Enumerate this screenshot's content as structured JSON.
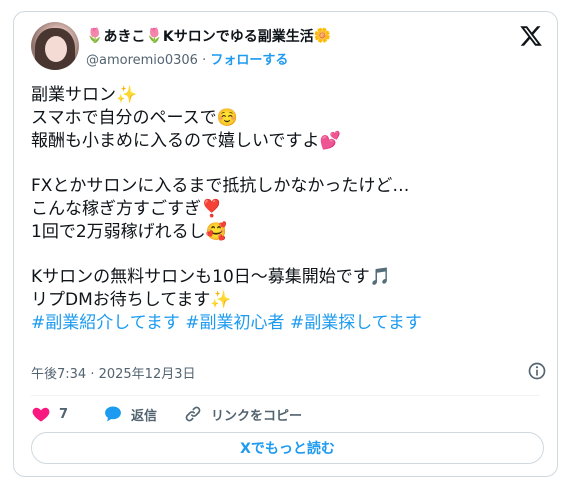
{
  "user": {
    "display_name_prefix": "🌷",
    "display_name_part1": "あきこ",
    "display_name_mid": "🌷",
    "display_name_part2": "Kサロンでゆる副業生活",
    "display_name_suffix": "🌼",
    "handle": "@amoremio0306",
    "separator": "·",
    "follow_label": "フォローする"
  },
  "icons": {
    "platform_logo": "x-logo-icon",
    "like": "heart-icon",
    "reply": "speech-bubble-icon",
    "copy_link": "link-icon",
    "info": "info-icon"
  },
  "post": {
    "lines": [
      {
        "text": "副業サロン",
        "emoji": "✨"
      },
      {
        "text": "スマホで自分のペースで",
        "emoji": "☺️"
      },
      {
        "text": "報酬も小まめに入るので嬉しいですよ",
        "emoji": "💕"
      },
      {
        "text": "",
        "emoji": ""
      },
      {
        "text": "FXとかサロンに入るまで抵抗しかなかったけど…",
        "emoji": ""
      },
      {
        "text": "こんな稼ぎ方すごすぎ",
        "emoji": "❣️"
      },
      {
        "text": "1回で2万弱稼げれるし",
        "emoji": "🥰"
      },
      {
        "text": "",
        "emoji": ""
      },
      {
        "text": "Kサロンの無料サロンも10日〜募集開始です",
        "emoji": "🎵"
      },
      {
        "text": "リプDMお待ちしてます",
        "emoji": "✨"
      }
    ],
    "hashtags": [
      "#副業紹介してます",
      "#副業初心者",
      "#副業探してます"
    ],
    "timestamp": "午後7:34 · 2025年12月3日"
  },
  "actions": {
    "like_count": "7",
    "reply_label": "返信",
    "copy_link_label": "リンクをコピー"
  },
  "read_more_label": "Xでもっと読む",
  "colors": {
    "accent": "#1d9bf0",
    "like": "#f91880",
    "text": "#0f1419",
    "muted": "#536471",
    "border": "#cfd9de"
  }
}
